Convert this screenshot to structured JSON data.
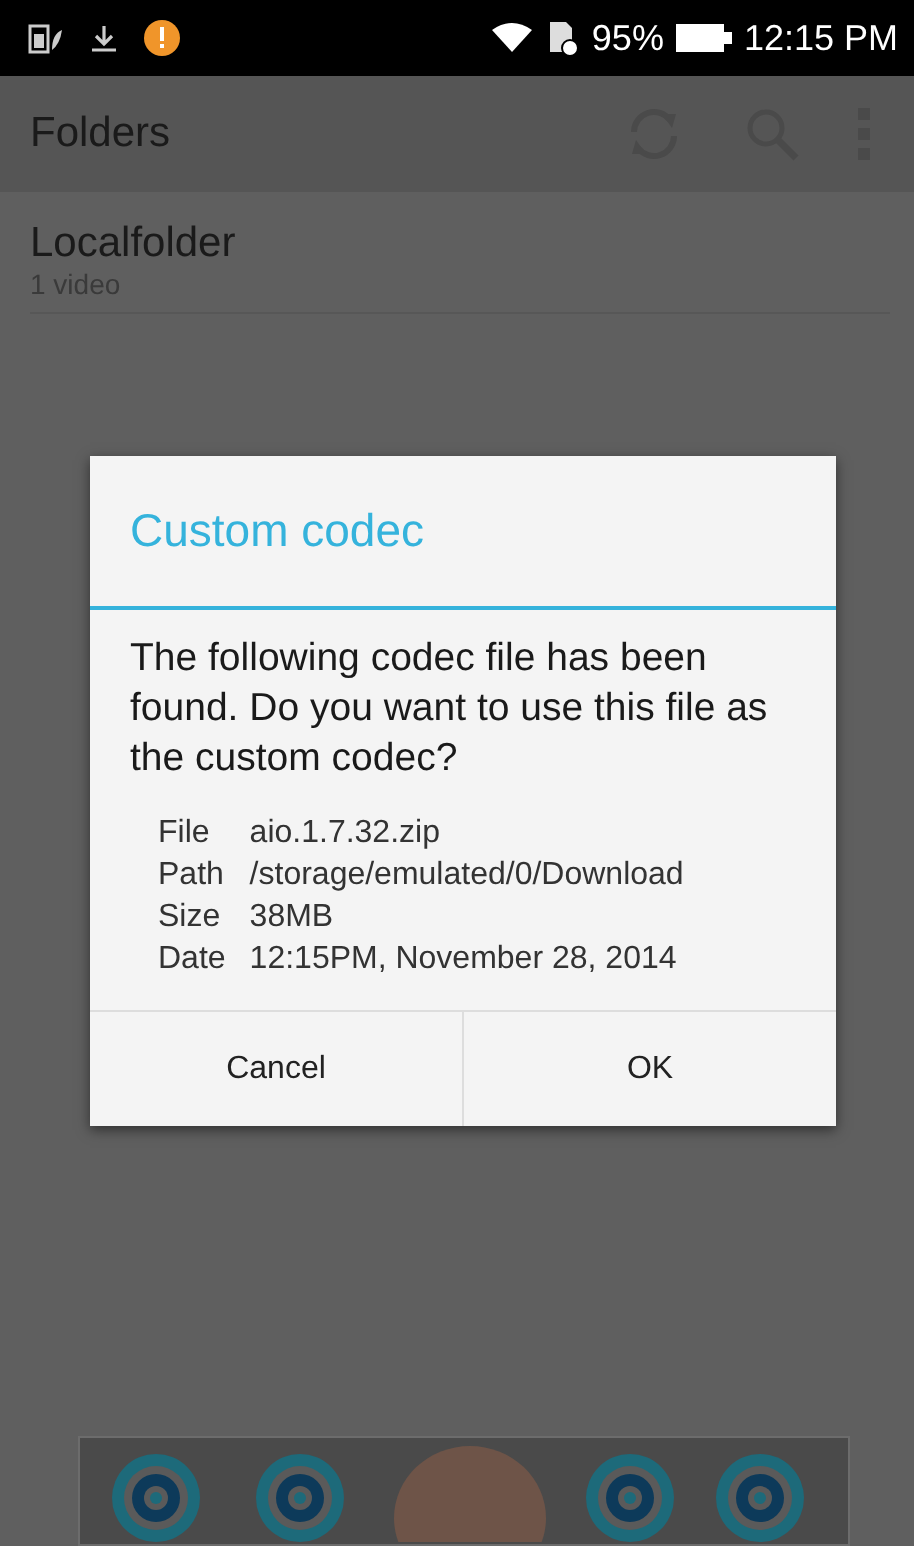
{
  "status_bar": {
    "battery_percent": "95%",
    "time": "12:15 PM"
  },
  "app_bar": {
    "title": "Folders"
  },
  "folders": [
    {
      "name": "Localfolder",
      "count": "1 video"
    }
  ],
  "dialog": {
    "title": "Custom codec",
    "message": "The following codec file has been found. Do you want to use this file as the custom codec?",
    "details": [
      {
        "label": "File",
        "value": "aio.1.7.32.zip"
      },
      {
        "label": "Path",
        "value": "/storage/emulated/0/Download"
      },
      {
        "label": "Size",
        "value": "38MB"
      },
      {
        "label": "Date",
        "value": "12:15PM, November 28, 2014"
      }
    ],
    "buttons": [
      "Cancel",
      "OK"
    ]
  }
}
